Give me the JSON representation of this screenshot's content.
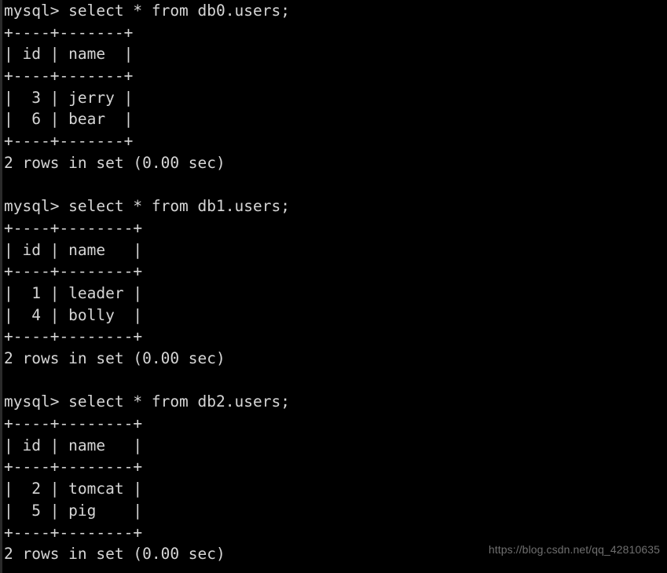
{
  "terminal": {
    "prompt": "mysql> ",
    "background_color": "#000000",
    "text_color": "#d6d6d6",
    "blocks": [
      {
        "command": "select * from db0.users;",
        "command_line": "mysql> select * from db0.users;",
        "database": "db0",
        "table": "users",
        "separator": "+----+-------+",
        "header_line": "| id | name  |",
        "columns": [
          "id",
          "name"
        ],
        "rows": [
          {
            "line": "|  3 | jerry |",
            "id": "3",
            "name": "jerry"
          },
          {
            "line": "|  6 | bear  |",
            "id": "6",
            "name": "bear"
          }
        ],
        "status": "2 rows in set (0.00 sec)"
      },
      {
        "command": "select * from db1.users;",
        "command_line": "mysql> select * from db1.users;",
        "database": "db1",
        "table": "users",
        "separator": "+----+--------+",
        "header_line": "| id | name   |",
        "columns": [
          "id",
          "name"
        ],
        "rows": [
          {
            "line": "|  1 | leader |",
            "id": "1",
            "name": "leader"
          },
          {
            "line": "|  4 | bolly  |",
            "id": "4",
            "name": "bolly"
          }
        ],
        "status": "2 rows in set (0.00 sec)"
      },
      {
        "command": "select * from db2.users;",
        "command_line": "mysql> select * from db2.users;",
        "database": "db2",
        "table": "users",
        "separator": "+----+--------+",
        "header_line": "| id | name   |",
        "columns": [
          "id",
          "name"
        ],
        "rows": [
          {
            "line": "|  2 | tomcat |",
            "id": "2",
            "name": "tomcat"
          },
          {
            "line": "|  5 | pig    |",
            "id": "5",
            "name": "pig"
          }
        ],
        "status": "2 rows in set (0.00 sec)"
      }
    ],
    "blank": " "
  },
  "watermark": {
    "text": "https://blog.csdn.net/qq_42810635",
    "color": "#6f6f6f"
  }
}
